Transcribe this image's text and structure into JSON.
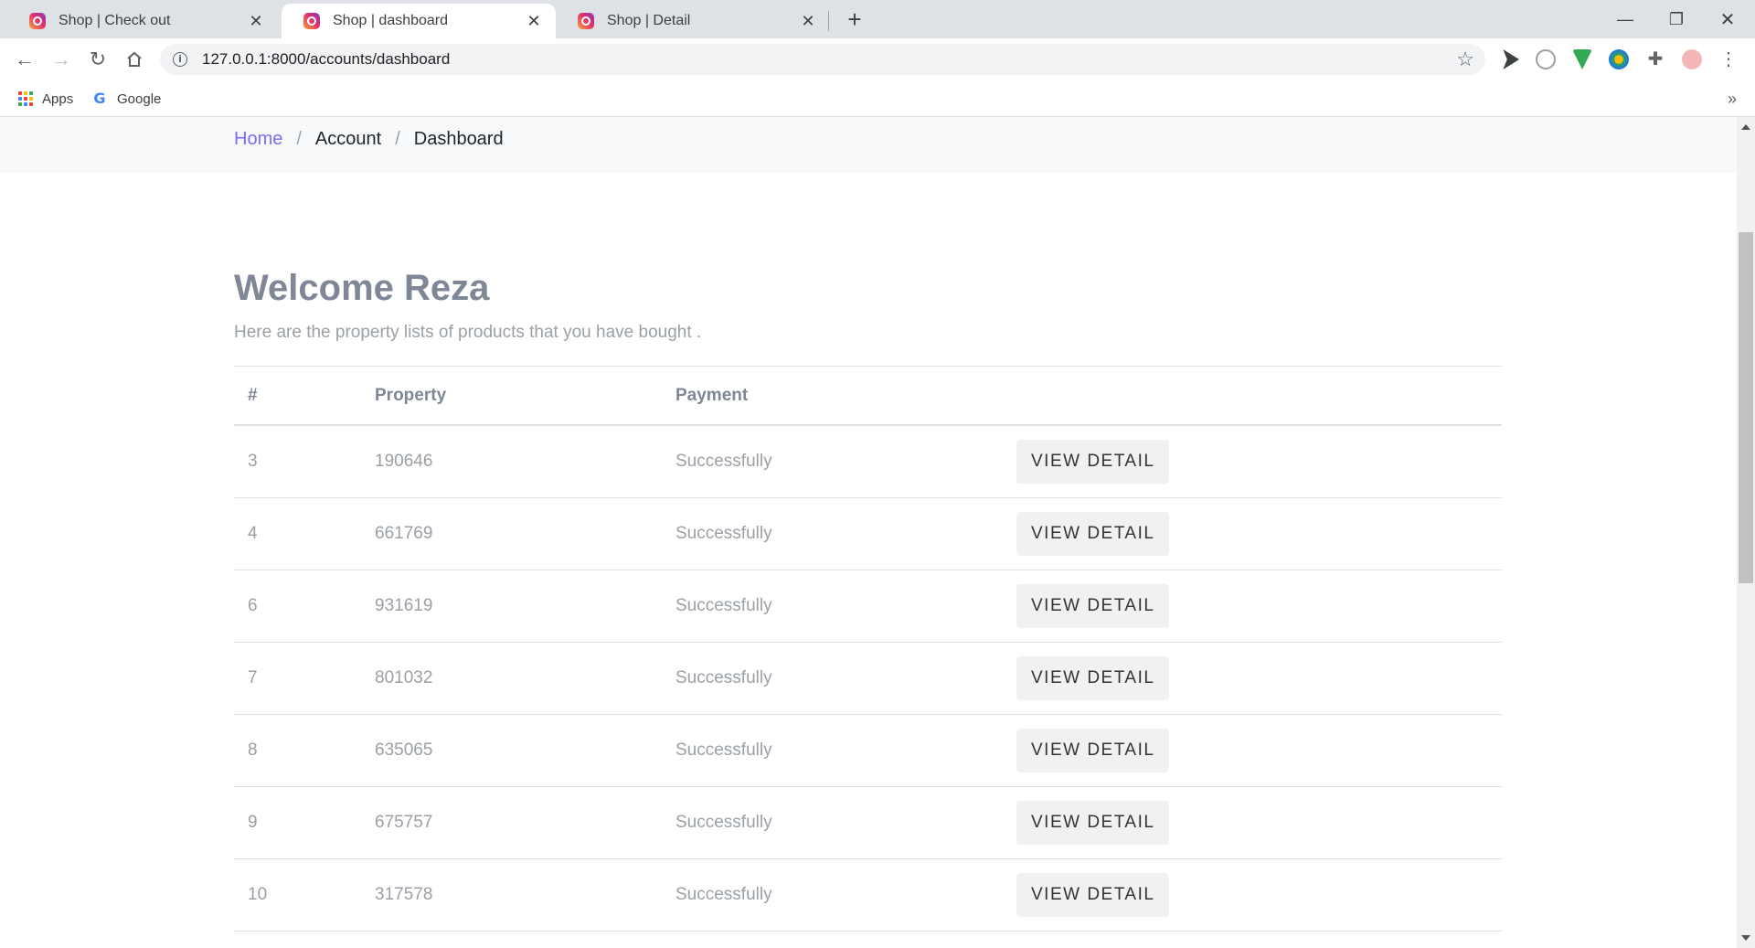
{
  "browser": {
    "tabs": [
      {
        "title": "Shop | Check out",
        "active": false
      },
      {
        "title": "Shop | dashboard",
        "active": true
      },
      {
        "title": "Shop | Detail",
        "active": false
      }
    ],
    "url": "127.0.0.1:8000/accounts/dashboard",
    "bookmarks": [
      {
        "label": "Apps",
        "icon": "apps-grid-icon"
      },
      {
        "label": "Google",
        "icon": "google-icon"
      }
    ]
  },
  "breadcrumb": {
    "home": "Home",
    "separator": "/",
    "account": "Account",
    "current": "Dashboard"
  },
  "page": {
    "welcome": "Welcome Reza",
    "lead": "Here are the property lists of products that you have bought ."
  },
  "table": {
    "headers": [
      "#",
      "Property",
      "Payment",
      ""
    ],
    "button_label": "VIEW DETAIL",
    "rows": [
      {
        "id": "3",
        "property": "190646",
        "payment": "Successfully"
      },
      {
        "id": "4",
        "property": "661769",
        "payment": "Successfully"
      },
      {
        "id": "6",
        "property": "931619",
        "payment": "Successfully"
      },
      {
        "id": "7",
        "property": "801032",
        "payment": "Successfully"
      },
      {
        "id": "8",
        "property": "635065",
        "payment": "Successfully"
      },
      {
        "id": "9",
        "property": "675757",
        "payment": "Successfully"
      },
      {
        "id": "10",
        "property": "317578",
        "payment": "Successfully"
      }
    ]
  },
  "colors": {
    "link": "#7b6cff",
    "heading": "#7f8796",
    "muted": "#9aa0a6",
    "button_bg": "#f1f1f3"
  }
}
